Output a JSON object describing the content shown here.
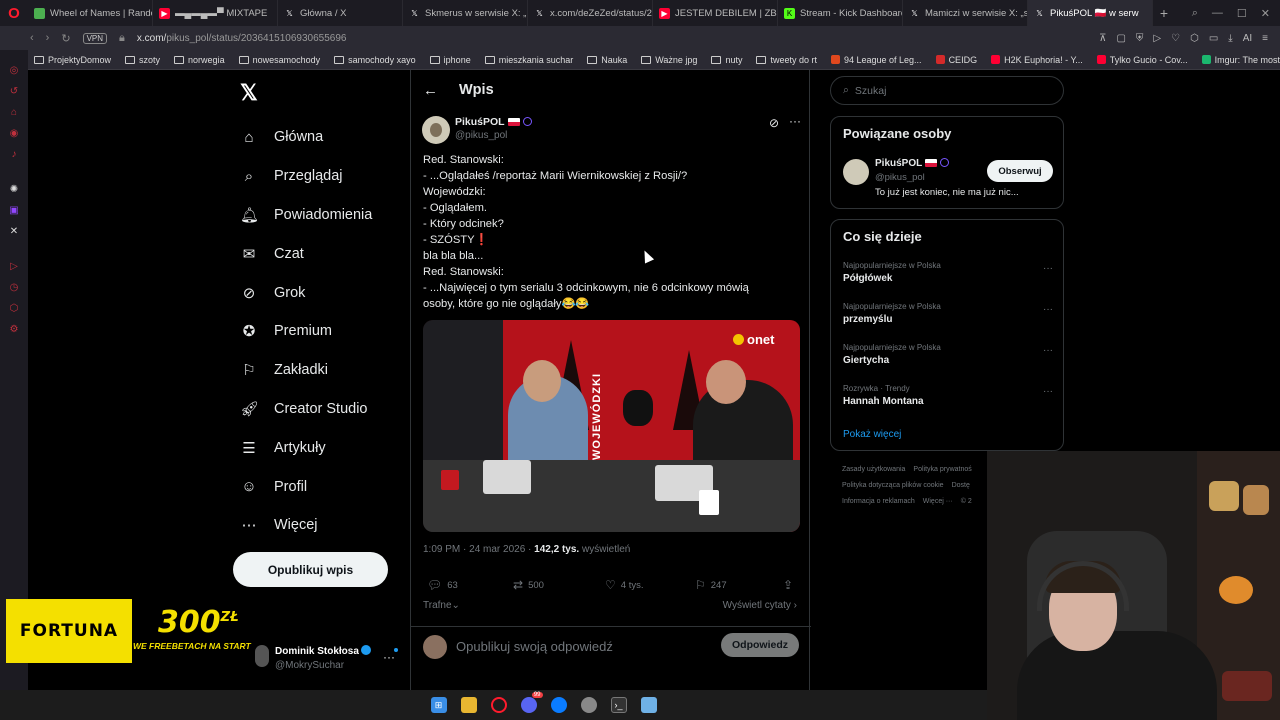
{
  "browser": {
    "tabs": [
      {
        "label": "Wheel of Names | Rando",
        "icon": "wheel-icon",
        "color": "#4caf50"
      },
      {
        "label": "▬▄▬▄▬▀ MIXTAPE",
        "icon": "youtube-icon",
        "color": "#ff0033"
      },
      {
        "label": "Główna / X",
        "icon": "x-icon",
        "color": "#ffffff"
      },
      {
        "label": "Skmerus w serwisie X: „P",
        "icon": "x-icon",
        "color": "#ffffff"
      },
      {
        "label": "x.com/deZeZed/status/20",
        "icon": "x-icon",
        "color": "#ffffff"
      },
      {
        "label": "JESTEM DEBILEM | ZBUD",
        "icon": "youtube-icon",
        "color": "#ff0033"
      },
      {
        "label": "Stream - Kick Dashboard",
        "icon": "kick-icon",
        "color": "#53fc18"
      },
      {
        "label": "Mamiczi w serwisie X: „s",
        "icon": "x-icon",
        "color": "#ffffff"
      },
      {
        "label": "PikuśPOL 🇵🇱 w serw",
        "icon": "x-icon",
        "color": "#ffffff"
      }
    ],
    "url_prefix": "x.com/",
    "url_path": "pikus_pol/status/2036415106930655696",
    "vpn_label": "VPN",
    "ai_label": "AI",
    "bookmarks": [
      {
        "label": "ProjektyDomow",
        "type": "folder"
      },
      {
        "label": "szoty",
        "type": "folder"
      },
      {
        "label": "norwegia",
        "type": "folder"
      },
      {
        "label": "nowesamochody",
        "type": "folder"
      },
      {
        "label": "samochody xayo",
        "type": "folder"
      },
      {
        "label": "iphone",
        "type": "folder"
      },
      {
        "label": "mieszkania suchar",
        "type": "folder"
      },
      {
        "label": "Nauka",
        "type": "folder"
      },
      {
        "label": "Ważne jpg",
        "type": "folder"
      },
      {
        "label": "nuty",
        "type": "folder"
      },
      {
        "label": "tweety do rt",
        "type": "folder"
      },
      {
        "label": "94 League of Leg...",
        "type": "site"
      },
      {
        "label": "CEIDG",
        "type": "site"
      },
      {
        "label": "H2K Euphoria! - Y...",
        "type": "site"
      },
      {
        "label": "Tylko Gucio - Cov...",
        "type": "site"
      },
      {
        "label": "Imgur: The most a...",
        "type": "site"
      }
    ]
  },
  "nav": {
    "items": [
      {
        "label": "Główna",
        "icon": "home-icon"
      },
      {
        "label": "Przeglądaj",
        "icon": "search-icon"
      },
      {
        "label": "Powiadomienia",
        "icon": "bell-icon"
      },
      {
        "label": "Czat",
        "icon": "mail-icon"
      },
      {
        "label": "Grok",
        "icon": "grok-icon"
      },
      {
        "label": "Premium",
        "icon": "premium-icon"
      },
      {
        "label": "Zakładki",
        "icon": "bookmark-icon"
      },
      {
        "label": "Creator Studio",
        "icon": "rocket-icon"
      },
      {
        "label": "Artykuły",
        "icon": "article-icon"
      },
      {
        "label": "Profil",
        "icon": "user-icon"
      },
      {
        "label": "Więcej",
        "icon": "more-icon"
      }
    ],
    "post_button": "Opublikuj wpis"
  },
  "account": {
    "name": "Dominik Stokłosa",
    "handle": "@MokrySuchar"
  },
  "ad": {
    "brand": "FORTUNA",
    "amount": "300",
    "currency": "ZŁ",
    "tagline": "WE FREEBETACH NA START"
  },
  "post": {
    "header_title": "Wpis",
    "author_name": "PikuśPOL",
    "author_handle": "@pikus_pol",
    "lines": [
      "Red. Stanowski:",
      "- ...Oglądałeś /reportaż Marii Wiernikowskiej z Rosji/?",
      "Wojewódzki:",
      "- Oglądałem.",
      "- Który odcinek?",
      "- SZÓSTY❗",
      "bla bla bla...",
      "Red. Stanowski:",
      "- ...Najwięcej o tym serialu 3 odcinkowym, nie 6 odcinkowy mówią",
      "osoby, które go nie oglądały😂😂"
    ],
    "media": {
      "brand": "onet",
      "wall_text": "WOJEWÓDZKI"
    },
    "time": "1:09 PM · 24 mar 2026 · ",
    "views": "142,2 tys.",
    "views_label": " wyświetleń",
    "replies": "63",
    "reposts": "500",
    "likes": "4 tys.",
    "bookmarks": "247",
    "sort_label": "Trafne",
    "quotes_label": "Wyświetl cytaty",
    "reply_placeholder": "Opublikuj swoją odpowiedź",
    "reply_button": "Odpowiedz"
  },
  "sidebar": {
    "search_placeholder": "Szukaj",
    "related_title": "Powiązane osoby",
    "related": {
      "name": "PikuśPOL",
      "handle": "@pikus_pol",
      "bio": "To już jest koniec, nie ma już nic...",
      "follow": "Obserwuj"
    },
    "trends_title": "Co się dzieje",
    "trends": [
      {
        "context": "Najpopularniejsze w Polska",
        "name": "Półgłówek"
      },
      {
        "context": "Najpopularniejsze w Polska",
        "name": "przemyślu"
      },
      {
        "context": "Najpopularniejsze w Polska",
        "name": "Giertycha"
      },
      {
        "context": "Rozrywka · Trendy",
        "name": "Hannah Montana"
      }
    ],
    "show_more": "Pokaż więcej",
    "footer": [
      "Zasady użytkowania",
      "Polityka prywatnoś",
      "Polityka dotycząca plików cookie",
      "Dostę",
      "Informacja o reklamach",
      "Więcej ···",
      "© 2"
    ]
  },
  "taskbar": {
    "apps": [
      "windows-start-icon",
      "file-explorer-icon",
      "opera-gx-icon",
      "discord-icon",
      "messenger-icon",
      "chrome-icon",
      "terminal-icon",
      "notepad-icon"
    ],
    "discord_badge": "99"
  }
}
